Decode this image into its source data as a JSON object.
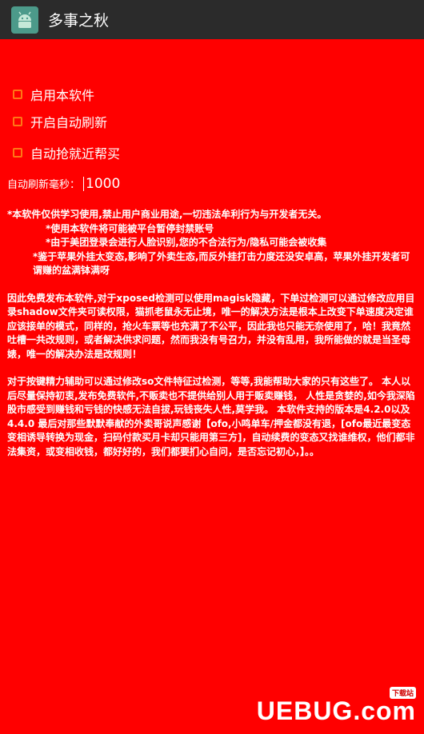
{
  "appbar": {
    "title": "多事之秋",
    "icon": "android-icon"
  },
  "options": [
    {
      "label": "启用本软件",
      "checked": false
    },
    {
      "label": "开启自动刷新",
      "checked": false
    },
    {
      "label": "自动抢就近帮买",
      "checked": false
    }
  ],
  "refresh": {
    "label": "自动刷新毫秒：",
    "value": "1000"
  },
  "notice": {
    "line1": "*本软件仅供学习使用,禁止用户商业用途,一切违法牟利行为与开发者无关。",
    "line2": "*使用本软件将可能被平台暂停封禁账号",
    "line3": "*由于美团登录会进行人脸识别,您的不合法行为/隐私可能会被收集",
    "line4": "*鉴于苹果外挂太变态,影响了外卖生态,而反外挂打击力度还没安卓高，苹果外挂开发者可谓赚的盆满钵满呀",
    "para1": "因此免费发布本软件,对于xposed检测可以使用magisk隐藏，下单过检测可以通过修改应用目录shadow文件夹可读权限，猫抓老鼠永无止境，唯一的解决方法是根本上改变下单速度决定谁应该接单的模式，同样的，抢火车票等也充满了不公平，因此我也只能无奈使用了，哈！我竟然吐槽一共改规则，或者解决供求问题，然而我没有号召力，并没有乱用，我所能做的就是当圣母婊，唯一的解决办法是改规则！",
    "para2": "对于按键精力辅助可以通过修改so文件特征过检测，等等,我能帮助大家的只有这些了。          本人以后尽量保持初衷,发布免费软件,不贩卖也不提供给别人用于贩卖赚钱，    人性是贪婪的,如今我深陷股市感受到赚钱和亏钱的快感无法自拔,玩钱丧失人性,莫学我。         本软件支持的版本是4.2.0以及4.4.0          最后对那些默默奉献的外卖哥说声感谢【ofo,小鸣单车/押金都没有退，[ofo最近最变态变相诱导转换为现金，扫码付款买月卡却只能用第三方]，自动续费的变态又找谁维权，他们都非法集资，或变相收钱，都好好的，我们都要扪心自问，是否忘记初心，】。。"
  },
  "watermark": {
    "text": "UEBUG.com",
    "sub": "下载站"
  },
  "colors": {
    "background": "#ff0000",
    "appbar": "#2b2b2b",
    "checkbox_border": "#ff8c1a",
    "app_icon_bg": "#4c9a8a"
  }
}
